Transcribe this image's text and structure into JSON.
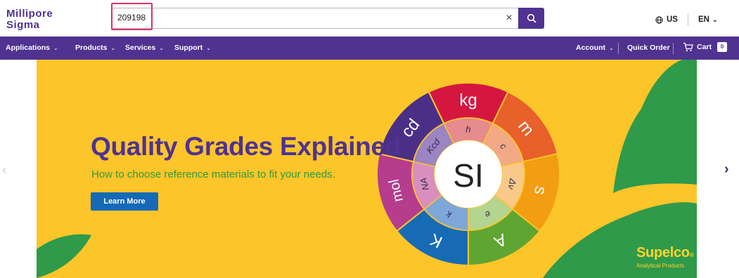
{
  "logo": {
    "line1": "Millipore",
    "line2": "Sigma"
  },
  "search": {
    "value": "209198",
    "clear_icon": "×"
  },
  "locale": {
    "country": "US",
    "language": "EN"
  },
  "nav": {
    "left": [
      "Applications",
      "Products",
      "Services",
      "Support"
    ],
    "account": "Account",
    "quick_order": "Quick Order",
    "cart": "Cart",
    "cart_count": "0"
  },
  "hero": {
    "title": "Quality Grades Explained",
    "subtitle": "How to choose reference materials to fit your needs.",
    "cta": "Learn More",
    "wheel_center": "SI",
    "outer_units": [
      "kg",
      "m",
      "s",
      "A",
      "K",
      "mol",
      "cd"
    ],
    "inner_constants": [
      "h",
      "c",
      "Δν",
      "e",
      "k",
      "NA",
      "Kcd"
    ],
    "brand": "Supelco",
    "brand_sub": "Analytical Products"
  },
  "colors": {
    "brand_purple": "#503291",
    "hero_yellow": "#fcc52a",
    "cta_blue": "#1569b6",
    "subtitle_green": "#2f9a3e",
    "search_highlight": "#e0306a"
  }
}
